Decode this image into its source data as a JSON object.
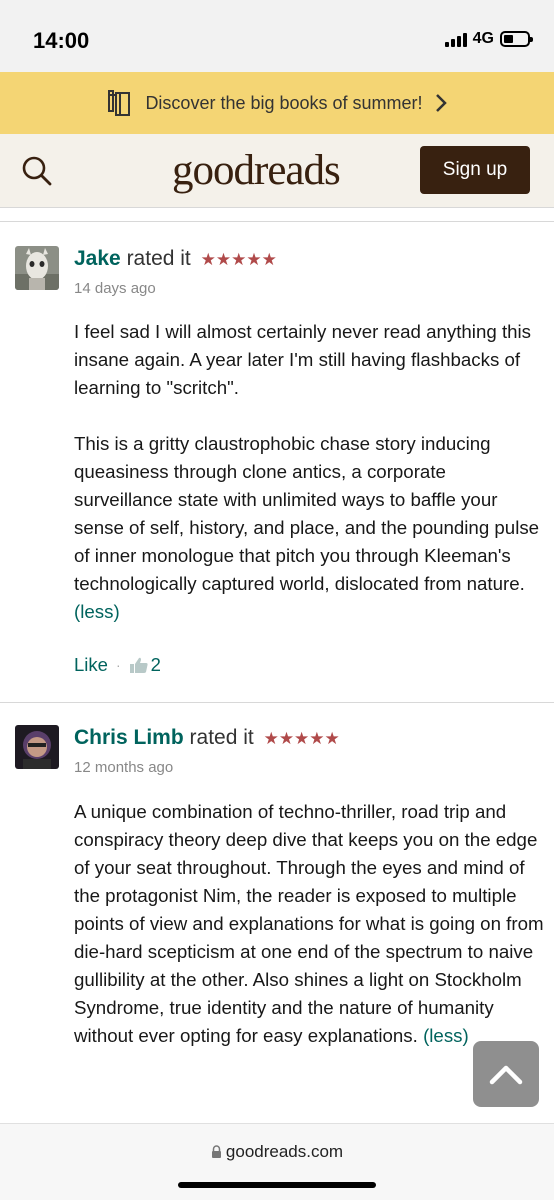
{
  "status_bar": {
    "time": "14:00",
    "network": "4G"
  },
  "promo": {
    "text": "Discover the big books of summer!",
    "icon": "books-icon",
    "chevron": "›"
  },
  "header": {
    "logo_part1": "good",
    "logo_part2": "reads",
    "signup_label": "Sign up",
    "search_icon": "search-icon"
  },
  "reviews": [
    {
      "name": "Jake",
      "rated_text": "rated it",
      "stars": "★★★★★",
      "rating": 5,
      "date": "14 days ago",
      "paragraphs": [
        "I feel sad I will almost certainly never read anything this insane again. A year later I'm still having flashbacks of learning to \"scritch\".",
        "This is a gritty claustrophobic chase story inducing queasiness through clone antics, a corporate surveillance state with unlimited ways to baffle your sense of self, history, and place, and the pounding pulse of inner monologue that pitch you through Kleeman's technologically captured world, dislocated from nature."
      ],
      "less_label": "(less)",
      "like_label": "Like",
      "like_count": "2"
    },
    {
      "name": "Chris Limb",
      "rated_text": "rated it",
      "stars": "★★★★★",
      "rating": 5,
      "date": "12 months ago",
      "paragraphs": [
        "A unique combination of techno-thriller, road trip and conspiracy theory deep dive that keeps you on the edge of your seat throughout. Through the eyes and mind of the protagonist Nim, the reader is exposed to multiple points of view and explanations for what is going on from die-hard scepticism at one end of the spectrum to naive gullibility at the other. Also shines a light on Stockholm Syndrome, true identity and the nature of humanity without ever opting for easy explanations."
      ],
      "less_label": "(less)"
    }
  ],
  "address_bar": {
    "url": "goodreads.com",
    "lock_icon": "lock-icon"
  },
  "colors": {
    "brand_brown": "#382110",
    "promo_yellow": "#f4d574",
    "link_green": "#00635d",
    "star_red": "#b04a4a",
    "header_beige": "#f4f1ea"
  }
}
